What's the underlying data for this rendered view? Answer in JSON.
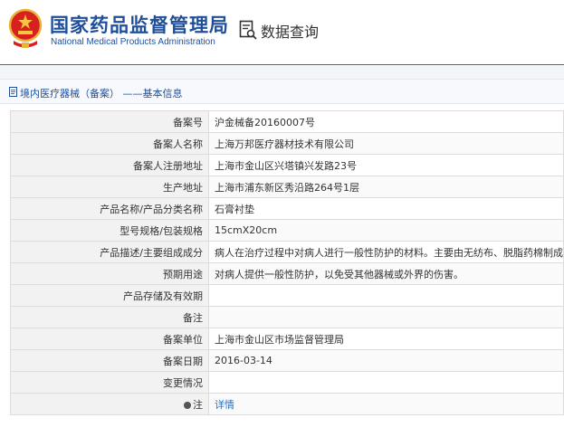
{
  "header": {
    "agency_cn": "国家药品监督管理局",
    "agency_en": "National Medical Products Administration",
    "query_title": "数据查询"
  },
  "breadcrumb": {
    "text": "境内医疗器械（备案） ——基本信息"
  },
  "record": {
    "rows": [
      {
        "label": "备案号",
        "value": "沪金械备20160007号"
      },
      {
        "label": "备案人名称",
        "value": "上海万邦医疗器材技术有限公司"
      },
      {
        "label": "备案人注册地址",
        "value": "上海市金山区兴塔镇兴发路23号"
      },
      {
        "label": "生产地址",
        "value": "上海市浦东新区秀沿路264号1层"
      },
      {
        "label": "产品名称/产品分类名称",
        "value": "石膏衬垫"
      },
      {
        "label": "型号规格/包装规格",
        "value": "15cmX20cm"
      },
      {
        "label": "产品描述/主要组成成分",
        "value": "病人在治疗过程中对病人进行一般性防护的材料。主要由无纺布、脱脂药棉制成。"
      },
      {
        "label": "预期用途",
        "value": "对病人提供一般性防护，以免受其他器械或外界的伤害。"
      },
      {
        "label": "产品存储及有效期",
        "value": ""
      },
      {
        "label": "备注",
        "value": ""
      },
      {
        "label": "备案单位",
        "value": "上海市金山区市场监督管理局"
      },
      {
        "label": "备案日期",
        "value": "2016-03-14"
      },
      {
        "label": "变更情况",
        "value": ""
      }
    ],
    "note_label": "注",
    "note_link": "详情"
  }
}
